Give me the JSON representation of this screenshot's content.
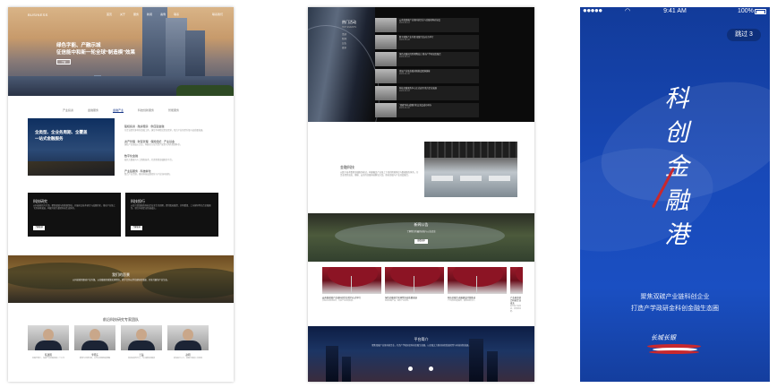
{
  "panel1": {
    "logo": "BUSINESS",
    "nav": [
      "首页",
      "关于",
      "服务",
      "新闻",
      "案例",
      "联系"
    ],
    "nav_right": "联系我们",
    "hero_line1": "绿色字能、产融示城",
    "hero_line2": "征信能中和新一轮全球“制造模”效果",
    "hero_button": "了解",
    "tabs": [
      "产业投资",
      "金融服务",
      "金融产业",
      "科技创新服务",
      "智能服务"
    ],
    "active_tab_index": 2,
    "feature_title": "全类型、全业务周期、全覆盖一站式金融服务",
    "list": [
      {
        "title": "股权投资 · 融资租赁 · 供应链金融",
        "desc": "为企业提供多样化金融工具，满足不同阶段资金需求，助力产业转型升级与高质量发展。"
      },
      {
        "title": "资产管理 · 财富管理 · 保险经纪 · 产业基金",
        "desc": "围绕产业链核心企业，构建全方位的资产配置与风险管理体系。"
      },
      {
        "title": "数字化金融",
        "desc": "依托大数据与人工智能技术，打造智慧金融服务平台。"
      },
      {
        "title": "产业链服务 · 科技孵化",
        "desc": "整合产业资源，推动科技成果转化与产业协同创新。"
      }
    ],
    "card1": {
      "title": "科技研究",
      "desc": "以科技创新为引领，聚焦双碳与新能源领域，开展前沿技术研究与成果转化，推动产业链上下游协同发展，构建开放共赢的科技生态体系。",
      "button": "了解更多"
    },
    "card2": {
      "title": "科技投行",
      "desc": "以投行思维服务科技企业全生命周期，提供股权融资、并购重组、上市辅导等综合金融服务，助力科创企业快速成长。",
      "button": "了解更多"
    },
    "landscape_title": "我们的愿景",
    "landscape_desc": "以科技创新驱动产业升级，以金融服务赋能实体经济，携手合作伙伴共建绿色低碳、开放共赢的产业生态。",
    "team_title": "前沿科技研究专家团队",
    "team": [
      {
        "name": "陈建国",
        "desc": "金融学博士，深耕产业金融领域二十余年"
      },
      {
        "name": "李晓东",
        "desc": "能源与环境专家，主导多项国家级课题"
      },
      {
        "name": "王磊",
        "desc": "科技投资合伙人，专注硬科技赛道"
      },
      {
        "name": "赵明",
        "desc": "资深投行人士，具备丰富的上市经验"
      }
    ]
  },
  "panel2": {
    "hot_title": "热门活动",
    "hot_sub": "HOT EVENTS",
    "hot_menu": [
      "活动",
      "新闻",
      "公告",
      "更多"
    ],
    "news": [
      {
        "title": "云南省双碳产业链科创企业与金融机构对接会",
        "date": "2023-06-12"
      },
      {
        "title": "数字赋能产业升级“双碳”论坛在京举行",
        "date": "2023-05-28"
      },
      {
        "title": "绿色金融研究院揭牌成立 推动产学研深度融合",
        "date": "2023-05-16"
      },
      {
        "title": "首届产业链金融创新峰会圆满落幕",
        "date": "2023-04-30"
      },
      {
        "title": "科技金融服务中心正式启用 助力企业发展",
        "date": "2023-04-18"
      },
      {
        "title": "“双碳”科技成果转化交流会成功举办",
        "date": "2023-04-02"
      }
    ],
    "fin_title": "金融科技",
    "fin_desc": "以数字技术重塑金融服务模式，构建覆盖产业链上下游的智能风控与数据服务体系，为企业提供高效、便捷、安全的金融科技解决方案，推动金融与产业深度融合。",
    "ann_title": "新闻公告",
    "ann_desc": "了解我们的最新动态与公告信息",
    "ann_button": "查看更多",
    "articles": [
      {
        "title": "云南省双碳产业链科创企业签约仪式举行",
        "desc": "多家企业现场签约，共促产业协同发展。"
      },
      {
        "title": "绿色金融助力实体经济高质量发展",
        "desc": "创新金融产品，服务产业转型。"
      },
      {
        "title": "科技金融生态圈建设持续推进",
        "desc": "产学研用深度融合，释放创新活力。"
      },
      {
        "title": "产业基金助力科创企业成长",
        "desc": "投早投小投科技，培育新动能。"
      }
    ],
    "footer_title": "平台简介",
    "footer_desc": "聚焦双碳产业链科创企业，打造产学政研金科创金融生态圈，以金融之力推动绿色低碳转型与科技创新发展。"
  },
  "panel3": {
    "time": "9:41 AM",
    "battery": "100%",
    "skip": "跳过 3",
    "calligraphy": [
      "科",
      "创",
      "金",
      "融",
      "港"
    ],
    "slogan1": "聚焦双碳产业链科创企业",
    "slogan2": "打造产学政研金科创金融生态圈",
    "brand": "长城长银",
    "colors": {
      "bg": "#1849b8",
      "accent": "#c8282e"
    }
  }
}
